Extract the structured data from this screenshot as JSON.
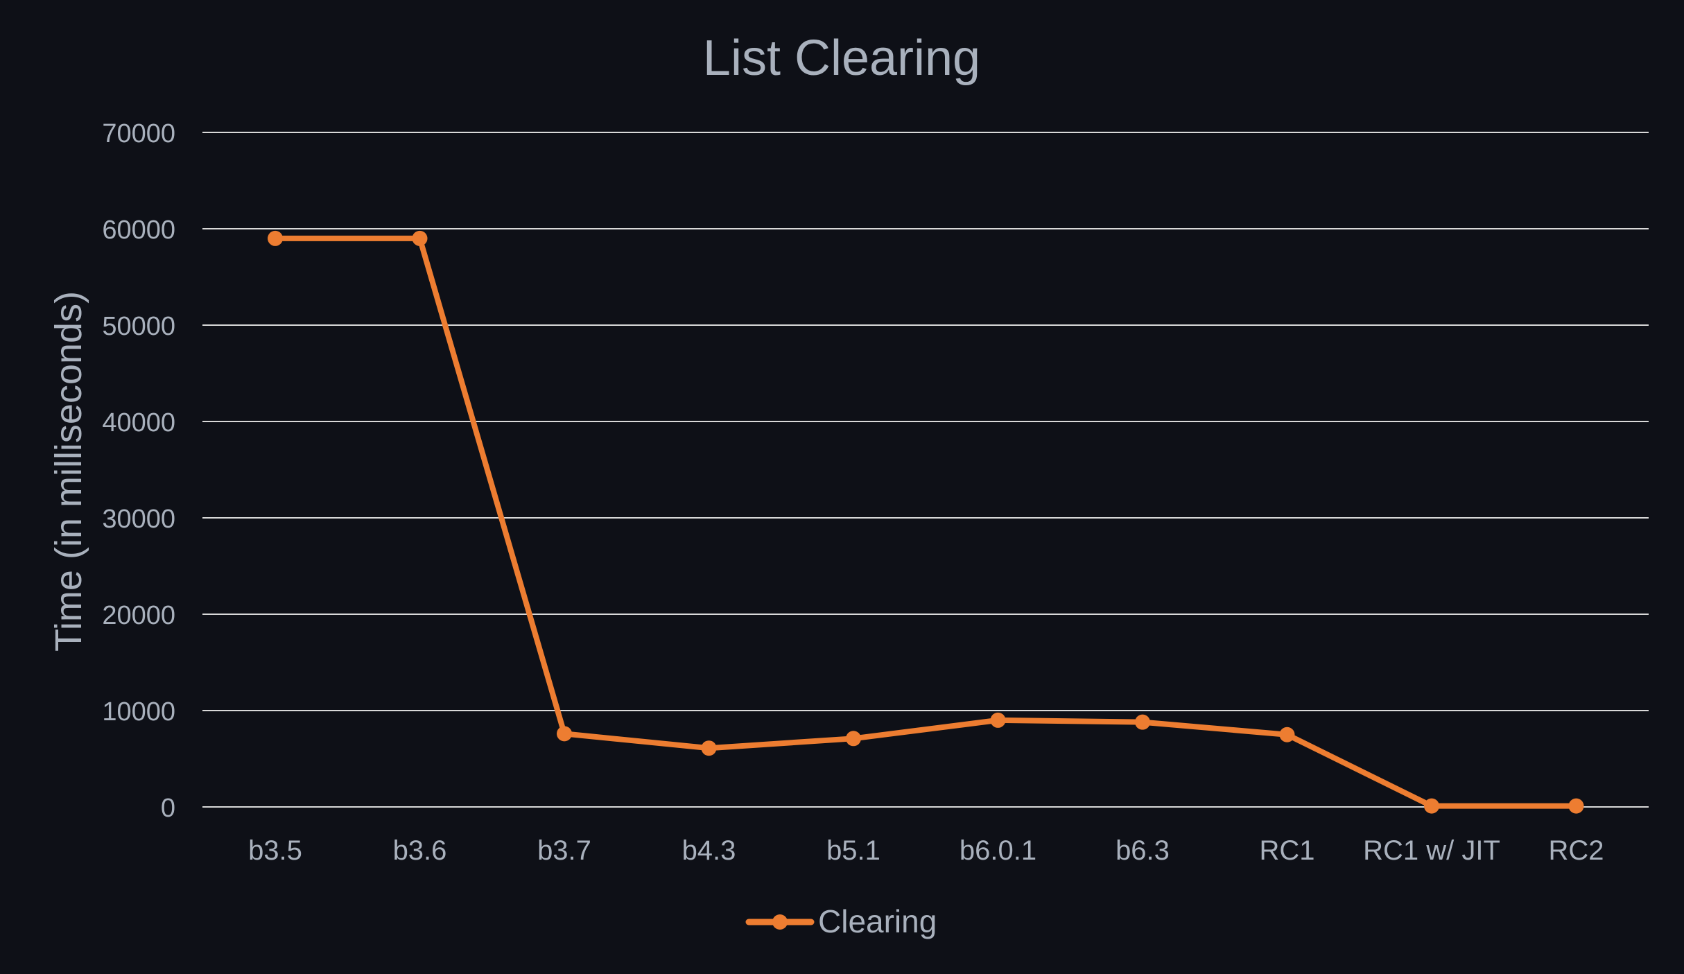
{
  "colors": {
    "background": "#0e1017",
    "text": "#a9b1bd",
    "gridline": "#d9d9d9",
    "series": "#ed7d31"
  },
  "chart_data": {
    "type": "line",
    "title": "List Clearing",
    "xlabel": "",
    "ylabel": "Time (in milliseconds)",
    "categories": [
      "b3.5",
      "b3.6",
      "b3.7",
      "b4.3",
      "b5.1",
      "b6.0.1",
      "b6.3",
      "RC1",
      "RC1 w/ JIT",
      "RC2"
    ],
    "series": [
      {
        "name": "Clearing",
        "values": [
          59000,
          59000,
          7600,
          6100,
          7100,
          9000,
          8800,
          7500,
          100,
          100
        ]
      }
    ],
    "ylim": [
      0,
      70000
    ],
    "yticks": [
      0,
      10000,
      20000,
      30000,
      40000,
      50000,
      60000,
      70000
    ],
    "ytick_labels": [
      "0",
      "10000",
      "20000",
      "30000",
      "40000",
      "50000",
      "60000",
      "70000"
    ],
    "grid": true,
    "legend_position": "bottom"
  }
}
